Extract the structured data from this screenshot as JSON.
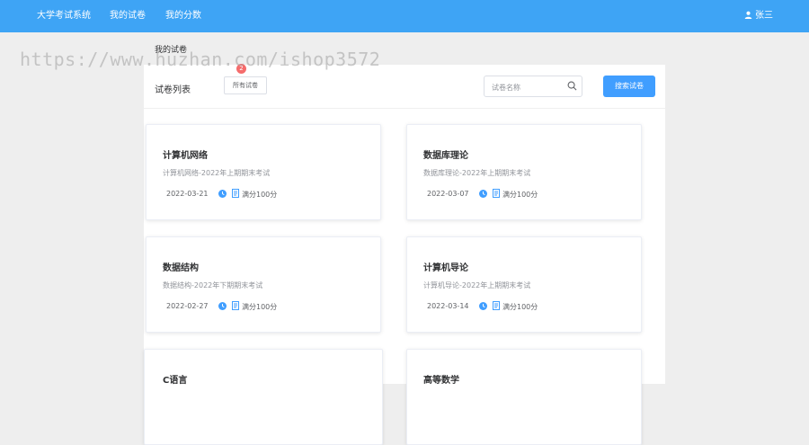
{
  "header": {
    "nav": [
      "大学考试系统",
      "我的试卷",
      "我的分数"
    ],
    "user_name": "张三"
  },
  "breadcrumb": "我的试卷",
  "badge": "2",
  "watermark": "https://www.huzhan.com/ishop3572",
  "list": {
    "title": "试卷列表",
    "filter_label": "所有试卷",
    "search_placeholder": "试卷名称",
    "search_button": "搜索试卷"
  },
  "exams": [
    {
      "title": "计算机网络",
      "desc": "计算机网络-2022年上期期末考试",
      "date": "2022-03-21",
      "score": "满分100分"
    },
    {
      "title": "数据库理论",
      "desc": "数据库理论-2022年上期期末考试",
      "date": "2022-03-07",
      "score": "满分100分"
    },
    {
      "title": "数据结构",
      "desc": "数据结构-2022年下期期末考试",
      "date": "2022-02-27",
      "score": "满分100分"
    },
    {
      "title": "计算机导论",
      "desc": "计算机导论-2022年上期期末考试",
      "date": "2022-03-14",
      "score": "满分100分"
    },
    {
      "title": "C语言",
      "desc": "",
      "date": "",
      "score": ""
    },
    {
      "title": "高等数学",
      "desc": "",
      "date": "",
      "score": ""
    }
  ],
  "colors": {
    "header": "#3ea4f5",
    "accent": "#409eff",
    "badge": "#f56c6c"
  }
}
